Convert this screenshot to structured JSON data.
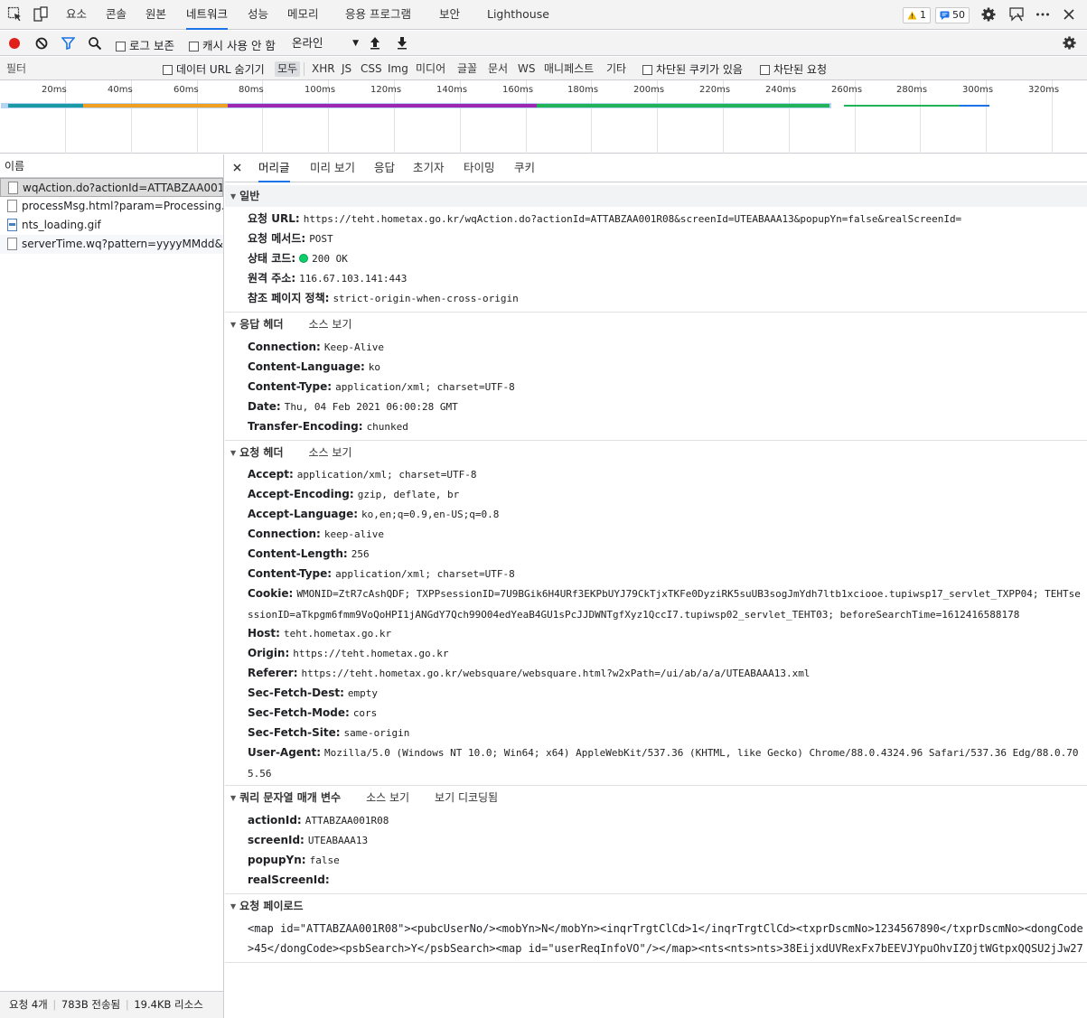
{
  "top_tabs": [
    "요소",
    "콘솔",
    "원본",
    "네트워크",
    "성능",
    "메모리",
    "응용 프로그램",
    "보안",
    "Lighthouse"
  ],
  "active_top_tab": "네트워크",
  "badges": {
    "warnings": "1",
    "messages": "50"
  },
  "colors": {
    "accent": "#1a73e8",
    "record": "#e0201a",
    "status_ok": "#0cce6b"
  },
  "toolbar": {
    "preserve_log": "로그 보존",
    "disable_cache": "캐시 사용 안 함",
    "throttle": "온라인"
  },
  "filter": {
    "placeholder": "필터",
    "hide_data_urls": "데이터 URL 숨기기",
    "types": [
      "모두",
      "XHR",
      "JS",
      "CSS",
      "Img",
      "미디어",
      "글꼴",
      "문서",
      "WS",
      "매니페스트",
      "기타"
    ],
    "blocked_cookies": "차단된 쿠키가 있음",
    "blocked_requests": "차단된 요청"
  },
  "timeline_ticks": [
    "20ms",
    "40ms",
    "60ms",
    "80ms",
    "100ms",
    "120ms",
    "140ms",
    "160ms",
    "180ms",
    "200ms",
    "220ms",
    "240ms",
    "260ms",
    "280ms",
    "300ms",
    "320ms"
  ],
  "requests": {
    "header": "이름",
    "items": [
      "wqAction.do?actionId=ATTABZAA001R...",
      "processMsg.html?param=Processing...",
      "nts_loading.gif",
      "serverTime.wq?pattern=yyyyMMdd&id..."
    ]
  },
  "status_bar": {
    "requests": "요청 4개",
    "transferred": "783B 전송됨",
    "resources": "19.4KB 리소스"
  },
  "detail_tabs": [
    "머리글",
    "미리 보기",
    "응답",
    "초기자",
    "타이밍",
    "쿠키"
  ],
  "general": {
    "title": "일반",
    "rows": [
      {
        "k": "요청 URL:",
        "v": "https://teht.hometax.go.kr/wqAction.do?actionId=ATTABZAA001R08&screenId=UTEABAAA13&popupYn=false&realScreenId="
      },
      {
        "k": "요청 메서드:",
        "v": "POST"
      },
      {
        "k": "상태 코드:",
        "v": "200 OK"
      },
      {
        "k": "원격 주소:",
        "v": "116.67.103.141:443"
      },
      {
        "k": "참조 페이지 정책:",
        "v": "strict-origin-when-cross-origin"
      }
    ]
  },
  "response_headers": {
    "title": "응답 헤더",
    "view_source": "소스 보기",
    "rows": [
      {
        "k": "Connection:",
        "v": "Keep-Alive"
      },
      {
        "k": "Content-Language:",
        "v": "ko"
      },
      {
        "k": "Content-Type:",
        "v": "application/xml; charset=UTF-8"
      },
      {
        "k": "Date:",
        "v": "Thu, 04 Feb 2021 06:00:28 GMT"
      },
      {
        "k": "Transfer-Encoding:",
        "v": "chunked"
      }
    ]
  },
  "request_headers": {
    "title": "요청 헤더",
    "view_source": "소스 보기",
    "rows": [
      {
        "k": "Accept:",
        "v": "application/xml; charset=UTF-8"
      },
      {
        "k": "Accept-Encoding:",
        "v": "gzip, deflate, br"
      },
      {
        "k": "Accept-Language:",
        "v": "ko,en;q=0.9,en-US;q=0.8"
      },
      {
        "k": "Connection:",
        "v": "keep-alive"
      },
      {
        "k": "Content-Length:",
        "v": "256"
      },
      {
        "k": "Content-Type:",
        "v": "application/xml; charset=UTF-8"
      },
      {
        "k": "Cookie:",
        "v": "WMONID=ZtR7cAshQDF; TXPPsessionID=7U9BGik6H4URf3EKPbUYJ79CkTjxTKFe0DyziRK5suUB3sogJmYdh7ltb1xciooe.tupiwsp17_servlet_TXPP04; TEHTsessionID=aTkpgm6fmm9VoQoHPI1jANGdY7Qch99O04edYeaB4GU1sPcJJDWNTgfXyz1QccI7.tupiwsp02_servlet_TEHT03; beforeSearchTime=1612416588178"
      },
      {
        "k": "Host:",
        "v": "teht.hometax.go.kr"
      },
      {
        "k": "Origin:",
        "v": "https://teht.hometax.go.kr"
      },
      {
        "k": "Referer:",
        "v": "https://teht.hometax.go.kr/websquare/websquare.html?w2xPath=/ui/ab/a/a/UTEABAAA13.xml"
      },
      {
        "k": "Sec-Fetch-Dest:",
        "v": "empty"
      },
      {
        "k": "Sec-Fetch-Mode:",
        "v": "cors"
      },
      {
        "k": "Sec-Fetch-Site:",
        "v": "same-origin"
      },
      {
        "k": "User-Agent:",
        "v": "Mozilla/5.0 (Windows NT 10.0; Win64; x64) AppleWebKit/537.36 (KHTML, like Gecko) Chrome/88.0.4324.96 Safari/537.36 Edg/88.0.705.56"
      }
    ]
  },
  "query_params": {
    "title": "쿼리 문자열 매개 변수",
    "view_source": "소스 보기",
    "view_decoded": "보기 디코딩됨",
    "rows": [
      {
        "k": "actionId:",
        "v": "ATTABZAA001R08"
      },
      {
        "k": "screenId:",
        "v": "UTEABAAA13"
      },
      {
        "k": "popupYn:",
        "v": "false"
      },
      {
        "k": "realScreenId:",
        "v": ""
      }
    ]
  },
  "payload": {
    "title": "요청 페이로드",
    "body": "<map id=\"ATTABZAA001R08\"><pubcUserNo/><mobYn>N</mobYn><inqrTrgtClCd>1</inqrTrgtClCd><txprDscmNo>1234567890</txprDscmNo><dongCode>45</dongCode><psbSearch>Y</psbSearch><map id=\"userReqInfoVO\"/></map><nts<nts>nts>38EijxdUVRexFx7bEEVJYpuOhvIZOjtWGtpxQQSU2jJw27"
  }
}
